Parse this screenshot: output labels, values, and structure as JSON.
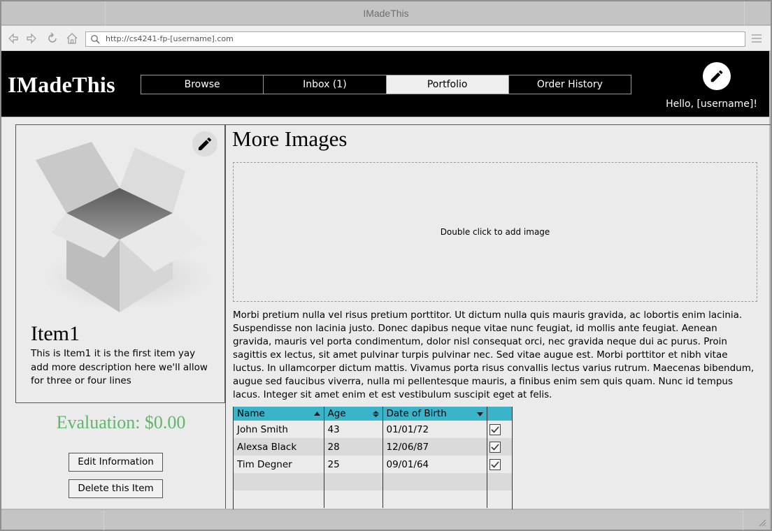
{
  "window": {
    "title": "IMadeThis"
  },
  "browser": {
    "url": "http://cs4241-fp-[username].com"
  },
  "header": {
    "brand": "IMadeThis",
    "tabs": [
      {
        "label": "Browse",
        "active": false
      },
      {
        "label": "Inbox (1)",
        "active": false
      },
      {
        "label": "Portfolio",
        "active": true
      },
      {
        "label": "Order History",
        "active": false
      }
    ],
    "greeting": "Hello, [username]!"
  },
  "item": {
    "title": "Item1",
    "description": "This is Item1 it is the first item yay add more description here we'll allow for three or four lines",
    "evaluation": "Evaluation: $0.00",
    "edit_label": "Edit Information",
    "delete_label": "Delete this Item"
  },
  "more_images": {
    "title": "More Images",
    "drop_hint": "Double click to add image",
    "paragraph": "Morbi pretium nulla vel risus pretium porttitor. Ut dictum nulla quis mauris gravida, ac lobortis enim lacinia. Suspendisse non lacinia justo. Donec dapibus neque vitae nunc feugiat, id mollis ante feugiat. Aenean gravida, mauris vel porta condimentum, dolor nisl consequat orci, nec gravida neque dui ac purus. Proin sagittis ex lectus, sit amet pulvinar turpis pulvinar nec. Sed vitae augue est. Morbi porttitor et nibh vitae luctus. In ullamcorper dictum mattis. Vivamus porta risus convallis lectus varius rutrum. Maecenas bibendum, augue sed faucibus viverra, nulla mi pellentesque mauris, a finibus enim sem quis quam. Nunc id tempus lacus. Integer sit amet enim et est vestibulum suscipit eget at felis."
  },
  "table": {
    "headers": [
      "Name",
      "Age",
      "Date of Birth",
      ""
    ],
    "rows": [
      {
        "name": "John Smith",
        "age": "43",
        "dob": "01/01/72",
        "checked": true
      },
      {
        "name": "Alexsa Black",
        "age": "28",
        "dob": "12/06/87",
        "checked": true
      },
      {
        "name": "Tim Degner",
        "age": "25",
        "dob": "09/01/64",
        "checked": true
      }
    ]
  },
  "colors": {
    "header_bg": "#000000",
    "table_header": "#3bb3c9",
    "evaluation": "#5db86a"
  }
}
